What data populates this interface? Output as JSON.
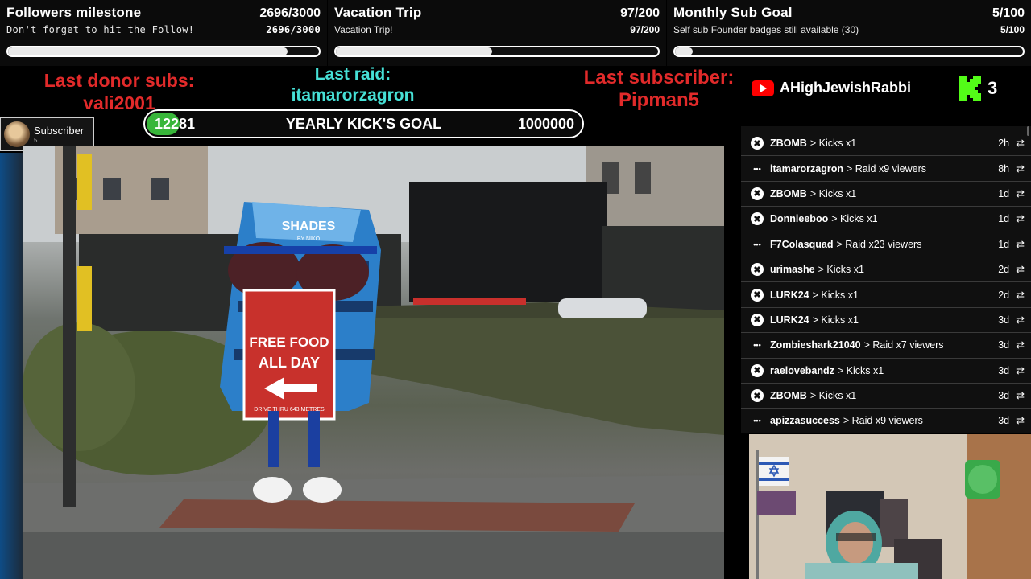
{
  "goals": [
    {
      "title": "Followers milestone",
      "count": "2696/3000",
      "subtitle": "Don't forget to hit the Follow!",
      "subcount": "2696/3000",
      "progress": 0.899
    },
    {
      "title": "Vacation Trip",
      "count": "97/200",
      "subtitle": "Vacation Trip!",
      "subcount": "97/200",
      "progress": 0.485
    },
    {
      "title": "Monthly Sub Goal",
      "count": "5/100",
      "subtitle": "Self sub Founder badges still available (30)",
      "subcount": "5/100",
      "progress": 0.05
    }
  ],
  "last_donor": {
    "label": "Last donor subs:",
    "name": "vali2001"
  },
  "last_raid": {
    "label": "Last raid:",
    "name": "itamarorzagron"
  },
  "last_subscriber": {
    "label": "Last subscriber:",
    "name": "Pipman5"
  },
  "yearly_goal": {
    "current": "12281",
    "label": "YEARLY KICK'S GOAL",
    "target": "1000000",
    "progress": 0.0123
  },
  "sub_badge": {
    "label": "Subscriber",
    "count": "5"
  },
  "youtube": {
    "name": "AHighJewishRabbi"
  },
  "kick": {
    "count": "3"
  },
  "colors": {
    "kick_green": "#53fc18",
    "donor_red": "#e12a2a",
    "raid_cyan": "#46e0d6",
    "youtube_red": "#ff0000",
    "goal_green": "#38b63a"
  },
  "feed": [
    {
      "type": "kicks",
      "user": "ZBOMB",
      "action": "> Kicks x1",
      "time": "2h"
    },
    {
      "type": "raid",
      "user": "itamarorzagron",
      "action": "> Raid x9 viewers",
      "time": "8h"
    },
    {
      "type": "kicks",
      "user": "ZBOMB",
      "action": "> Kicks x1",
      "time": "1d"
    },
    {
      "type": "kicks",
      "user": "Donnieeboo",
      "action": "> Kicks x1",
      "time": "1d"
    },
    {
      "type": "raid",
      "user": "F7Colasquad",
      "action": "> Raid x23 viewers",
      "time": "1d"
    },
    {
      "type": "kicks",
      "user": "urimashe",
      "action": "> Kicks x1",
      "time": "2d"
    },
    {
      "type": "kicks",
      "user": "LURK24",
      "action": "> Kicks x1",
      "time": "2d"
    },
    {
      "type": "kicks",
      "user": "LURK24",
      "action": "> Kicks x1",
      "time": "3d"
    },
    {
      "type": "raid",
      "user": "Zombieshark21040",
      "action": "> Raid x7 viewers",
      "time": "3d"
    },
    {
      "type": "kicks",
      "user": "raelovebandz",
      "action": "> Kicks x1",
      "time": "3d"
    },
    {
      "type": "kicks",
      "user": "ZBOMB",
      "action": "> Kicks x1",
      "time": "3d"
    },
    {
      "type": "raid",
      "user": "apizzasuccess",
      "action": "> Raid x9 viewers",
      "time": "3d"
    }
  ],
  "video": {
    "bag_brand": "SHADES",
    "bag_sub": "BY NIKO",
    "sign_line1": "FREE FOOD",
    "sign_line2": "ALL DAY",
    "sign_small": "DRIVE THRU 643 METRES"
  }
}
